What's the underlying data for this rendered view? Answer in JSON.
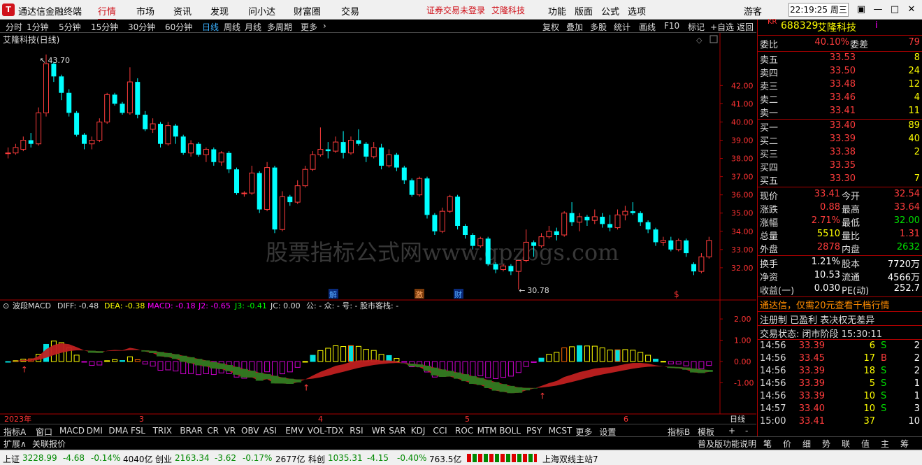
{
  "app": {
    "title": "通达信金融终端",
    "menus": [
      "行情",
      "市场",
      "资讯",
      "发现",
      "问小达",
      "财富圈",
      "交易"
    ],
    "notice": "证券交易未登录",
    "stock_link": "艾隆科技",
    "right_menus": [
      "功能",
      "版面",
      "公式",
      "选项"
    ],
    "user": "游客",
    "time": "22:19:25 周三"
  },
  "toolbar": {
    "periods": [
      "分时",
      "1分钟",
      "5分钟",
      "15分钟",
      "30分钟",
      "60分钟",
      "日线",
      "周线",
      "月线",
      "多周期",
      "更多"
    ],
    "tools": [
      "复权",
      "叠加",
      "多股",
      "统计",
      "画线",
      "F10",
      "标记",
      "+自选",
      "返回"
    ]
  },
  "chart": {
    "title": "艾隆科技(日线)",
    "high_label": "43.70",
    "low_label": "30.78",
    "y_labels": [
      "42.00",
      "41.00",
      "40.00",
      "39.00",
      "38.00",
      "37.00",
      "36.00",
      "35.00",
      "34.00",
      "33.00",
      "32.00"
    ],
    "watermark": "股票指标公式网www.gpzbgs.com",
    "event_marks": [
      "解",
      "激",
      "财",
      "$"
    ],
    "x_labels": [
      "2023年",
      "3",
      "4",
      "5",
      "6"
    ],
    "period_label": "日线",
    "macd": {
      "header": "波段MACD",
      "diff": "DIFF: -0.48",
      "dea": "DEA: -0.38",
      "macd": "MACD: -0.18",
      "j2": "J2: -0.65",
      "j3": "J3: -0.41",
      "jc": "JC: 0.00",
      "extra": "公: -  众: -  号: -  股市客栈: -",
      "y_labels": [
        "2.00",
        "1.00",
        "0.00",
        "-1.00"
      ]
    }
  },
  "chart_data": {
    "type": "candlestick",
    "title": "艾隆科技(日线)",
    "ylim": [
      30.5,
      44.2
    ],
    "candles": [
      [
        38.3,
        38.6,
        38.0,
        38.3
      ],
      [
        38.3,
        38.8,
        38.2,
        38.6
      ],
      [
        38.5,
        39.2,
        38.4,
        39.0
      ],
      [
        39.0,
        39.4,
        38.6,
        38.8
      ],
      [
        38.8,
        40.8,
        38.7,
        40.5
      ],
      [
        40.5,
        43.7,
        40.3,
        43.2
      ],
      [
        43.2,
        43.3,
        42.2,
        42.5
      ],
      [
        42.5,
        42.6,
        41.2,
        41.6
      ],
      [
        41.6,
        41.8,
        40.3,
        40.5
      ],
      [
        40.5,
        40.6,
        39.2,
        39.3
      ],
      [
        39.3,
        39.4,
        38.5,
        38.8
      ],
      [
        38.8,
        39.2,
        38.5,
        39.0
      ],
      [
        39.0,
        40.2,
        38.9,
        40.0
      ],
      [
        40.0,
        41.6,
        39.9,
        41.5
      ],
      [
        41.5,
        41.6,
        40.9,
        41.0
      ],
      [
        41.0,
        41.1,
        40.4,
        40.5
      ],
      [
        40.5,
        43.0,
        40.4,
        42.2
      ],
      [
        42.2,
        42.4,
        40.2,
        40.4
      ],
      [
        40.4,
        40.6,
        39.5,
        39.6
      ],
      [
        39.6,
        40.2,
        39.4,
        39.9
      ],
      [
        39.9,
        40.0,
        38.6,
        38.8
      ],
      [
        38.8,
        40.0,
        38.7,
        39.8
      ],
      [
        39.8,
        39.9,
        38.8,
        39.2
      ],
      [
        39.2,
        39.3,
        38.2,
        38.3
      ],
      [
        38.3,
        39.0,
        38.1,
        38.8
      ],
      [
        38.8,
        38.9,
        38.1,
        38.2
      ],
      [
        38.2,
        38.6,
        37.8,
        38.5
      ],
      [
        38.5,
        38.6,
        37.6,
        37.8
      ],
      [
        37.8,
        38.4,
        37.6,
        38.3
      ],
      [
        38.3,
        38.4,
        37.2,
        37.4
      ],
      [
        37.4,
        37.5,
        36.0,
        36.1
      ],
      [
        36.1,
        36.2,
        35.9,
        36.1
      ],
      [
        36.1,
        37.6,
        36.0,
        37.2
      ],
      [
        37.2,
        37.3,
        35.0,
        35.2
      ],
      [
        35.2,
        37.8,
        35.1,
        37.5
      ],
      [
        37.5,
        37.6,
        33.9,
        34.1
      ],
      [
        34.1,
        36.2,
        34.0,
        35.9
      ],
      [
        35.9,
        36.0,
        35.4,
        35.6
      ],
      [
        35.6,
        36.8,
        35.5,
        36.5
      ],
      [
        36.5,
        37.6,
        36.4,
        37.4
      ],
      [
        37.4,
        38.4,
        37.3,
        38.2
      ],
      [
        38.2,
        39.7,
        38.1,
        38.5
      ],
      [
        38.5,
        38.9,
        38.0,
        38.4
      ],
      [
        38.4,
        39.2,
        38.3,
        38.9
      ],
      [
        38.9,
        39.5,
        38.0,
        38.3
      ],
      [
        38.3,
        39.2,
        38.2,
        39.0
      ],
      [
        39.0,
        39.6,
        38.7,
        38.8
      ],
      [
        38.8,
        38.9,
        37.8,
        38.1
      ],
      [
        38.1,
        38.9,
        38.0,
        38.6
      ],
      [
        38.6,
        38.8,
        37.4,
        37.6
      ],
      [
        37.6,
        38.5,
        37.5,
        38.2
      ],
      [
        38.2,
        38.3,
        37.3,
        37.5
      ],
      [
        37.5,
        37.6,
        36.6,
        36.8
      ],
      [
        36.8,
        36.9,
        35.9,
        36.0
      ],
      [
        36.0,
        37.0,
        35.9,
        36.9
      ],
      [
        36.9,
        37.0,
        34.7,
        34.9
      ],
      [
        34.9,
        35.0,
        33.8,
        34.0
      ],
      [
        34.0,
        35.3,
        33.9,
        35.1
      ],
      [
        35.1,
        36.0,
        35.0,
        35.9
      ],
      [
        35.9,
        36.0,
        34.1,
        34.3
      ],
      [
        34.3,
        34.4,
        33.6,
        33.8
      ],
      [
        33.8,
        33.9,
        33.0,
        33.2
      ],
      [
        33.2,
        33.7,
        33.1,
        33.6
      ],
      [
        33.6,
        33.7,
        32.1,
        32.2
      ],
      [
        32.2,
        32.3,
        31.7,
        31.9
      ],
      [
        31.9,
        32.2,
        31.8,
        32.1
      ],
      [
        32.1,
        32.2,
        31.6,
        31.8
      ],
      [
        31.8,
        32.4,
        30.8,
        32.4
      ],
      [
        32.4,
        34.1,
        32.3,
        33.4
      ],
      [
        33.4,
        33.5,
        32.6,
        33.2
      ],
      [
        33.2,
        33.9,
        33.1,
        33.7
      ],
      [
        33.7,
        34.3,
        33.6,
        34.0
      ],
      [
        34.0,
        34.2,
        33.5,
        33.8
      ],
      [
        33.8,
        35.1,
        33.7,
        35.0
      ],
      [
        35.0,
        35.6,
        34.3,
        34.5
      ],
      [
        34.5,
        35.0,
        34.0,
        34.8
      ],
      [
        34.8,
        34.9,
        34.3,
        34.6
      ],
      [
        34.6,
        35.2,
        34.4,
        34.8
      ],
      [
        34.8,
        35.0,
        34.2,
        34.4
      ],
      [
        34.4,
        34.9,
        34.0,
        34.2
      ],
      [
        34.2,
        35.2,
        34.1,
        34.9
      ],
      [
        34.9,
        35.4,
        34.6,
        35.1
      ],
      [
        35.1,
        35.6,
        34.9,
        35.0
      ],
      [
        35.0,
        35.1,
        34.3,
        34.5
      ],
      [
        34.5,
        34.6,
        33.9,
        34.1
      ],
      [
        34.1,
        34.2,
        33.2,
        33.4
      ],
      [
        33.4,
        33.7,
        33.2,
        33.5
      ],
      [
        33.5,
        33.7,
        32.9,
        33.0
      ],
      [
        33.0,
        33.6,
        32.9,
        33.5
      ],
      [
        33.5,
        33.6,
        32.6,
        32.8
      ],
      [
        32.2,
        32.3,
        31.6,
        31.8
      ],
      [
        31.8,
        32.8,
        31.7,
        32.6
      ],
      [
        32.6,
        33.7,
        32.5,
        33.5
      ]
    ]
  },
  "quote": {
    "code": "688329",
    "name": "艾隆科技",
    "weibi_label": "委比",
    "weibi": "40.10%",
    "weicha_label": "委差",
    "weicha": "79",
    "asks": [
      {
        "label": "卖五",
        "price": "33.53",
        "vol": "8"
      },
      {
        "label": "卖四",
        "price": "33.50",
        "vol": "24"
      },
      {
        "label": "卖三",
        "price": "33.48",
        "vol": "12"
      },
      {
        "label": "卖二",
        "price": "33.46",
        "vol": "4"
      },
      {
        "label": "卖一",
        "price": "33.41",
        "vol": "11"
      }
    ],
    "bids": [
      {
        "label": "买一",
        "price": "33.40",
        "vol": "89"
      },
      {
        "label": "买二",
        "price": "33.39",
        "vol": "40"
      },
      {
        "label": "买三",
        "price": "33.38",
        "vol": "2"
      },
      {
        "label": "买四",
        "price": "33.35",
        "vol": ""
      },
      {
        "label": "买五",
        "price": "33.30",
        "vol": "7"
      }
    ],
    "stats": [
      [
        "现价",
        "33.41",
        "今开",
        "32.54"
      ],
      [
        "涨跌",
        "0.88",
        "最高",
        "33.64"
      ],
      [
        "涨幅",
        "2.71%",
        "最低",
        "32.00"
      ],
      [
        "总量",
        "5510",
        "量比",
        "1.31"
      ],
      [
        "外盘",
        "2878",
        "内盘",
        "2632"
      ]
    ],
    "stats2": [
      [
        "换手",
        "1.21%",
        "股本",
        "7720万"
      ],
      [
        "净资",
        "10.53",
        "流通",
        "4566万"
      ],
      [
        "收益(一)",
        "0.030",
        "PE(动)",
        "252.7"
      ]
    ],
    "promo": "通达信，仅需20元查看千档行情",
    "info": "注册制 已盈利 表决权无差异",
    "trade_status": "交易状态: 闭市阶段 15:30:11",
    "ticks": [
      [
        "14:56",
        "33.39",
        "6",
        "S",
        "2"
      ],
      [
        "14:56",
        "33.45",
        "17",
        "B",
        "2"
      ],
      [
        "14:56",
        "33.39",
        "18",
        "S",
        "2"
      ],
      [
        "14:56",
        "33.39",
        "5",
        "S",
        "1"
      ],
      [
        "14:56",
        "33.39",
        "10",
        "S",
        "1"
      ],
      [
        "14:57",
        "33.40",
        "10",
        "S",
        "3"
      ],
      [
        "15:00",
        "33.41",
        "37",
        "",
        "10"
      ]
    ],
    "tabs": [
      "笔",
      "价",
      "细",
      "势",
      "联",
      "值",
      "主",
      "筹"
    ]
  },
  "indicators": [
    "指标A",
    "窗口",
    "MACD",
    "DMI",
    "DMA",
    "FSL",
    "TRIX",
    "BRAR",
    "CR",
    "VR",
    "OBV",
    "ASI",
    "EMV",
    "VOL-TDX",
    "RSI",
    "WR",
    "SAR",
    "KDJ",
    "CCI",
    "ROC",
    "MTM",
    "BOLL",
    "PSY",
    "MCST",
    "更多",
    "设置"
  ],
  "indicator_right": [
    "指标B",
    "模板",
    "+",
    "-"
  ],
  "bar2": {
    "left": [
      "扩展∧",
      "关联报价"
    ],
    "right": "普及版功能说明"
  },
  "status": {
    "sh_label": "上证",
    "sh": "3228.99",
    "sh_chg": "-4.68",
    "sh_pct": "-0.14%",
    "sh_amt": "4040亿",
    "cy_label": "创业",
    "cy": "2163.34",
    "cy_chg": "-3.62",
    "cy_pct": "-0.17%",
    "cy_amt": "2677亿",
    "kc_label": "科创",
    "kc": "1035.31",
    "kc_chg": "-4.15",
    "kc_pct": "-0.40%",
    "kc_amt": "763.5亿",
    "server": "上海双线主站7"
  }
}
